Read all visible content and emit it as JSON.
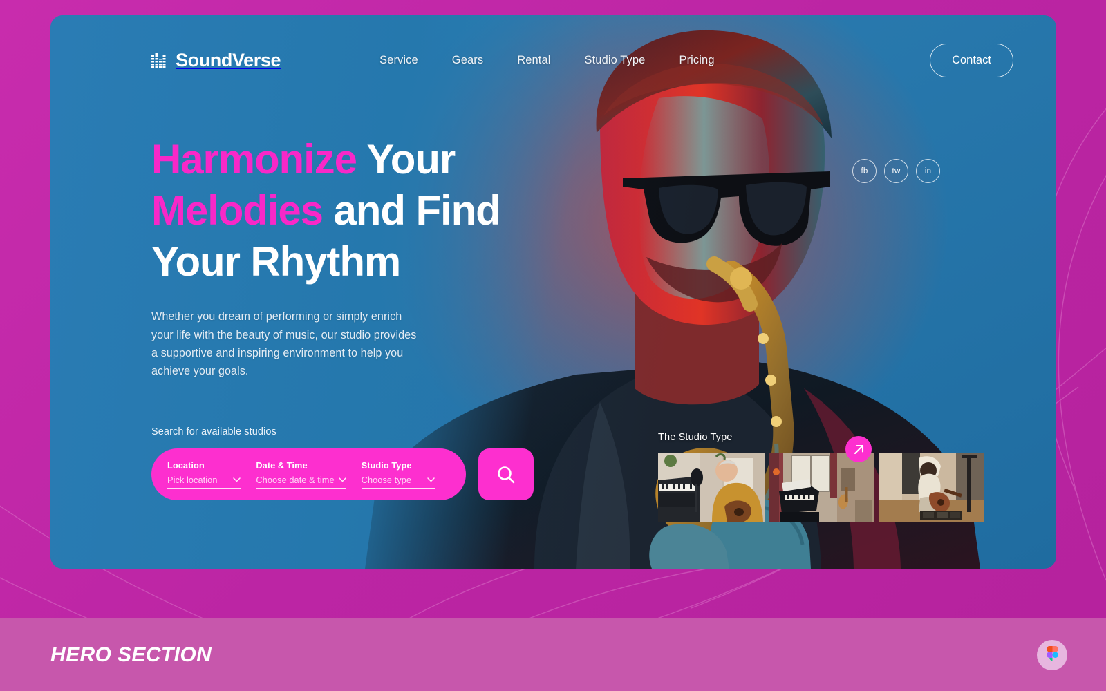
{
  "theme": {
    "canvas_magenta": "#bf27a8",
    "hero_blue": "#2276ae",
    "accent_pink": "#fd2fcf",
    "headline_pink": "#f828c8",
    "footer_band": "#c757ac"
  },
  "navbar": {
    "brand_name": "SoundVerse",
    "brand_mark_icon": "equalizer-bars-icon",
    "links": [
      {
        "label": "Service"
      },
      {
        "label": "Gears"
      },
      {
        "label": "Rental"
      },
      {
        "label": "Studio Type"
      },
      {
        "label": "Pricing"
      }
    ],
    "contact_label": "Contact"
  },
  "social": {
    "items": [
      {
        "label": "fb",
        "icon": "facebook-icon"
      },
      {
        "label": "tw",
        "icon": "twitter-icon"
      },
      {
        "label": "in",
        "icon": "linkedin-icon"
      }
    ]
  },
  "hero": {
    "headline": {
      "line1_accent": "Harmonize",
      "line1_rest": " Your",
      "line2_accent": "Melodies",
      "line2_rest": " and Find",
      "line3": "Your Rhythm"
    },
    "subcopy": "Whether you dream of performing or simply enrich your life with the beauty of music, our studio provides a supportive and inspiring environment to help you achieve your goals."
  },
  "search": {
    "label": "Search for available studios",
    "submit_icon": "magnifier-icon",
    "fields": [
      {
        "label": "Location",
        "value": "Pick location",
        "icon": "chevron-down-icon"
      },
      {
        "label": "Date & Time",
        "value": "Choose date & time",
        "icon": "chevron-down-icon"
      },
      {
        "label": "Studio Type",
        "value": "Choose type",
        "icon": "chevron-down-icon"
      }
    ]
  },
  "studio_type": {
    "title": "The Studio Type",
    "cta_icon": "arrow-up-right-icon",
    "thumbnails": [
      {
        "alt": "guitarist-with-keyboard-and-mic"
      },
      {
        "alt": "grand-piano-in-living-room"
      },
      {
        "alt": "electric-guitarist-with-pedalboard"
      }
    ]
  },
  "footer": {
    "title": "HERO SECTION",
    "badge_icon": "figma-logo-icon"
  }
}
